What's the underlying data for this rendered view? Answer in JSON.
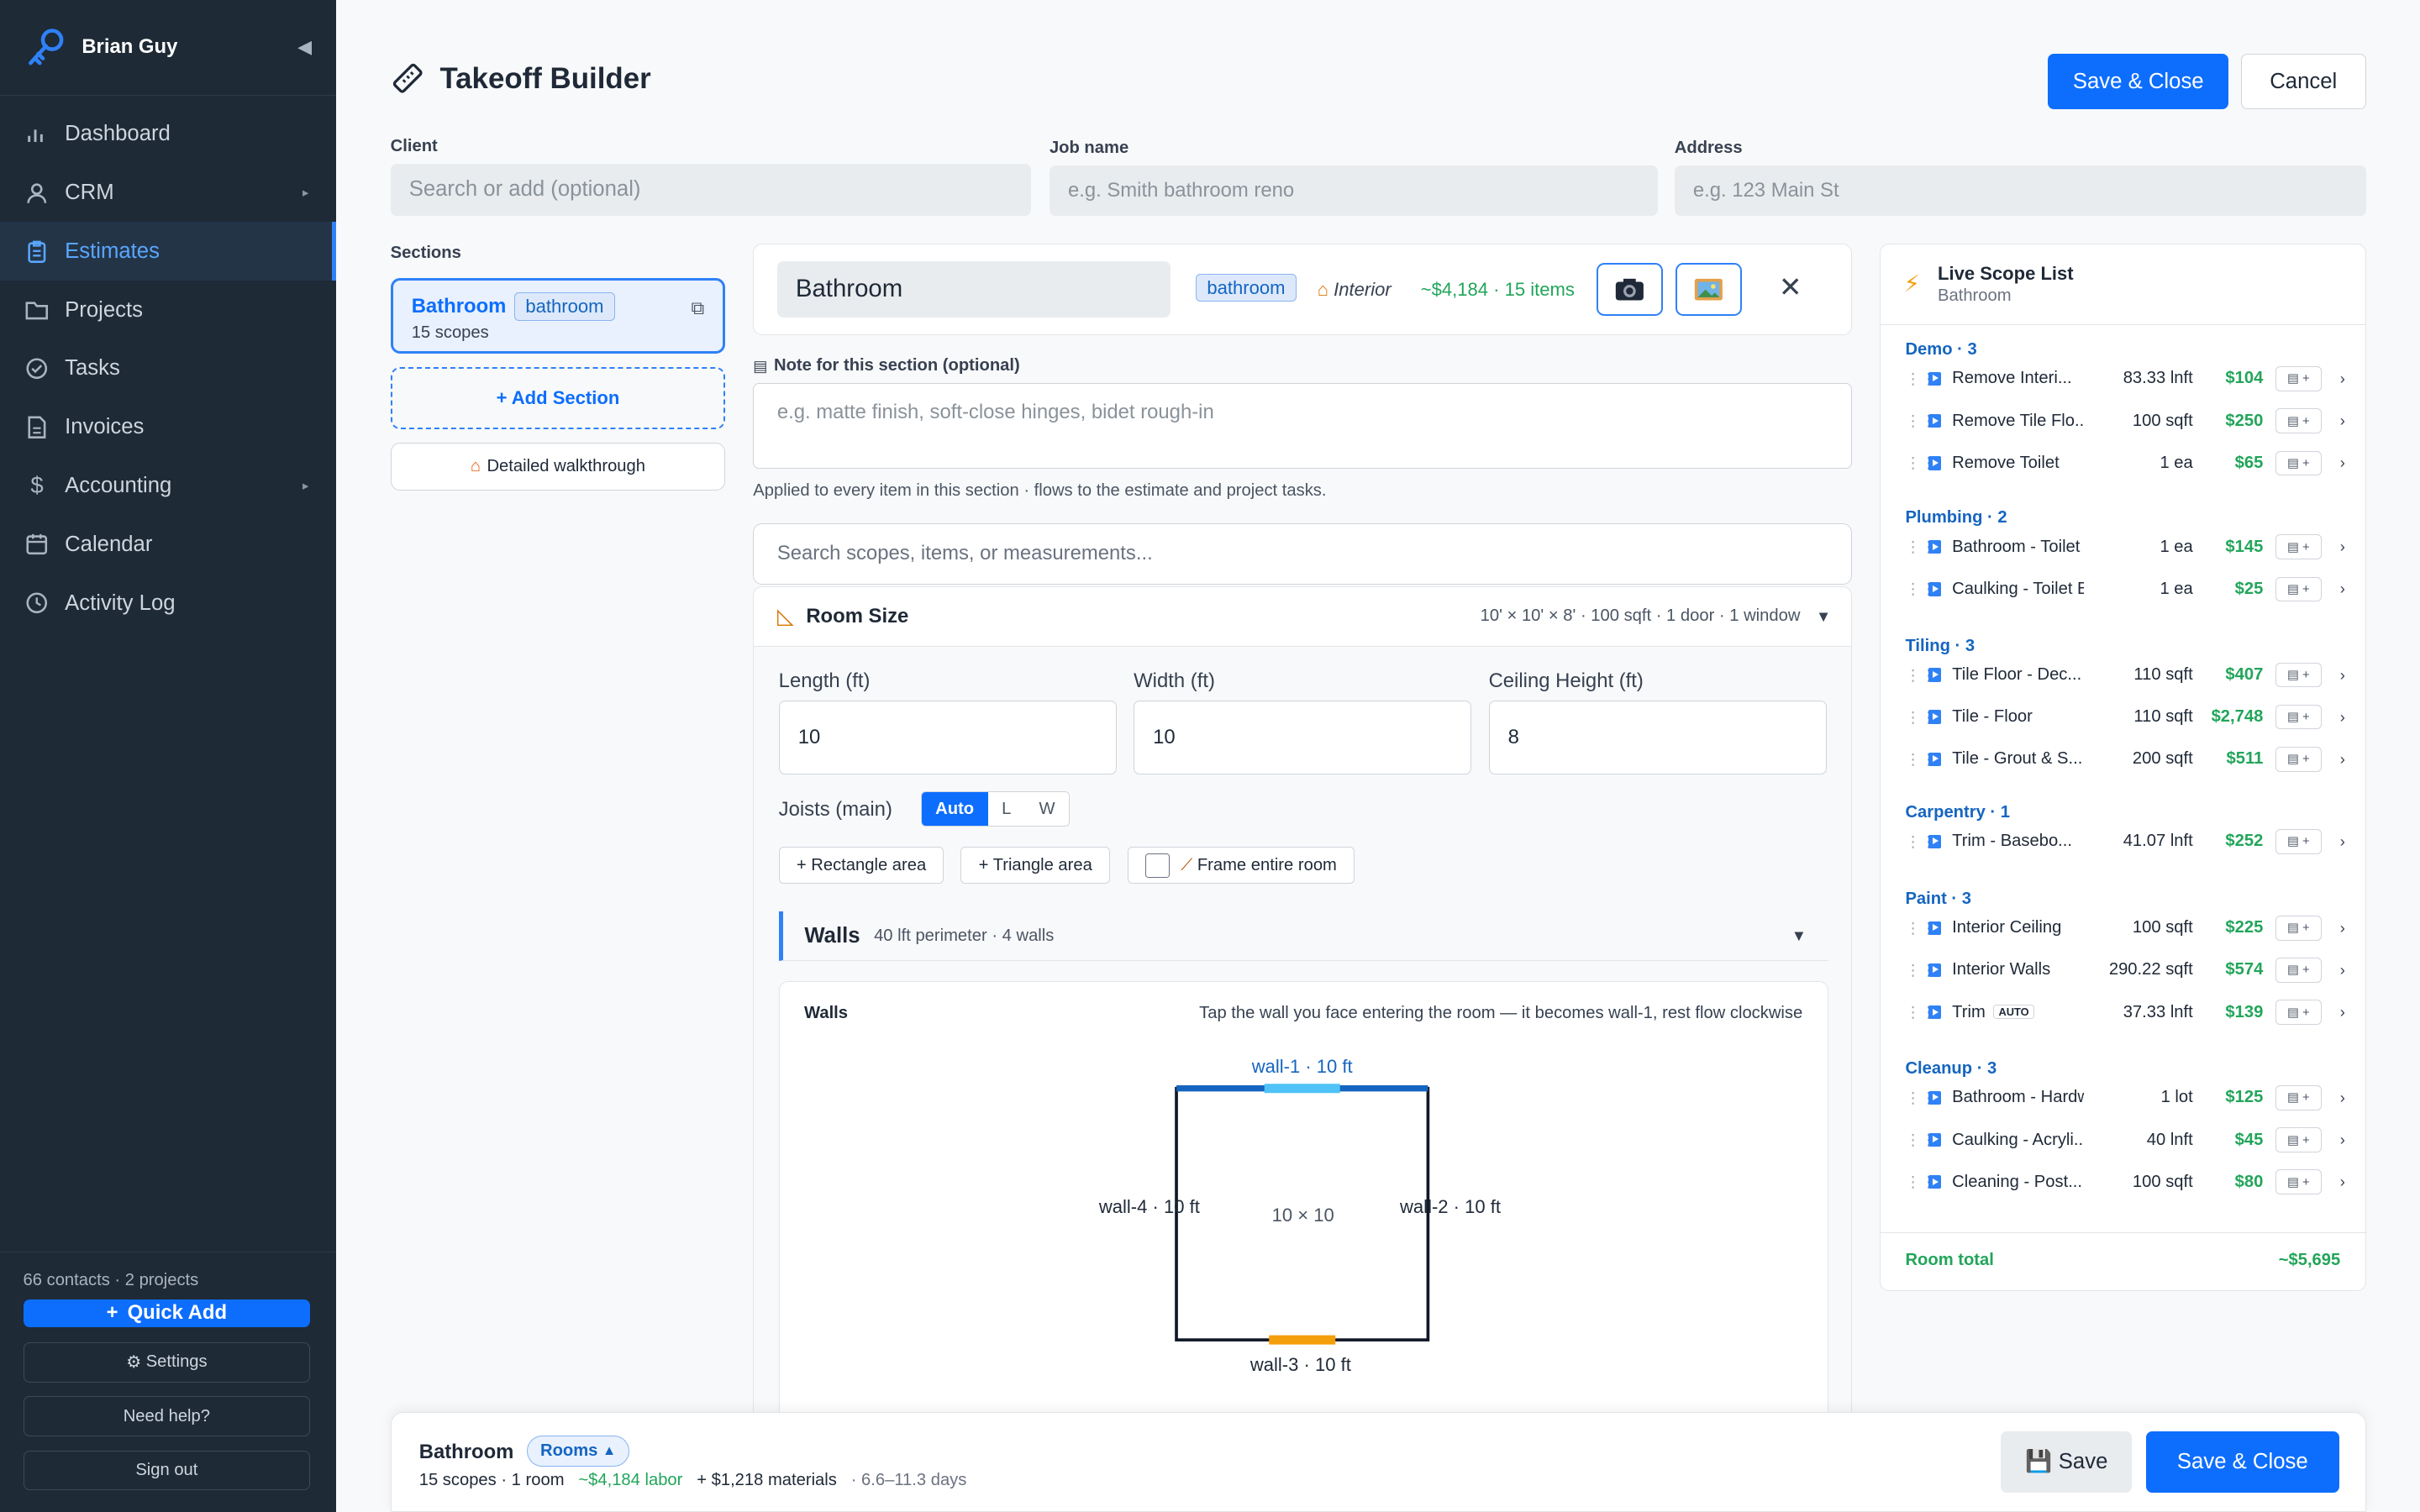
{
  "sidebar": {
    "user": "Brian Guy",
    "nav": [
      {
        "label": "Dashboard",
        "icon": "chart-icon"
      },
      {
        "label": "CRM",
        "icon": "user-icon"
      },
      {
        "label": "Estimates",
        "icon": "clipboard-icon"
      },
      {
        "label": "Projects",
        "icon": "folder-icon"
      },
      {
        "label": "Tasks",
        "icon": "check-circle-icon"
      },
      {
        "label": "Invoices",
        "icon": "document-icon"
      },
      {
        "label": "Accounting",
        "icon": "dollar-icon"
      },
      {
        "label": "Calendar",
        "icon": "calendar-icon"
      },
      {
        "label": "Activity Log",
        "icon": "clock-icon"
      }
    ],
    "active": "Estimates",
    "stats": "66 contacts · 2 projects",
    "quick_add": "Quick Add",
    "settings": "Settings",
    "help": "Need help?",
    "signout": "Sign out"
  },
  "header": {
    "title": "Takeoff Builder",
    "save_close": "Save & Close",
    "cancel": "Cancel"
  },
  "fields": {
    "client_label": "Client",
    "client_placeholder": "Search or add (optional)",
    "job_label": "Job name",
    "job_placeholder": "e.g. Smith bathroom reno",
    "address_label": "Address",
    "address_placeholder": "e.g. 123 Main St"
  },
  "sections": {
    "label": "Sections",
    "items": [
      {
        "name": "Bathroom",
        "tag": "bathroom",
        "sub": "15 scopes"
      }
    ],
    "add": "+ Add Section",
    "walkthrough": "Detailed walkthrough"
  },
  "section_header": {
    "name": "Bathroom",
    "tag": "bathroom",
    "interior": "Interior",
    "total": "~$4,184 · 15 items"
  },
  "note": {
    "label": "Note for this section (optional)",
    "placeholder": "e.g. matte finish, soft-close hinges, bidet rough-in",
    "hint": "Applied to every item in this section · flows to the estimate and project tasks."
  },
  "search": {
    "placeholder": "Search scopes, items, or measurements..."
  },
  "room_size": {
    "title": "Room Size",
    "meta": "10' × 10' × 8' · 100 sqft · 1 door · 1 window",
    "length_label": "Length (ft)",
    "length": "10",
    "width_label": "Width (ft)",
    "width": "10",
    "height_label": "Ceiling Height (ft)",
    "height": "8",
    "joists_label": "Joists (main)",
    "joists_options": [
      "Auto",
      "L",
      "W"
    ],
    "joists_selected": "Auto",
    "rect_area": "+ Rectangle area",
    "tri_area": "+ Triangle area",
    "frame_room": "Frame entire room",
    "frame_checked": false
  },
  "walls": {
    "title": "Walls",
    "meta": "40 lft perimeter · 4 walls",
    "card_title": "Walls",
    "hint": "Tap the wall you face entering the room — it becomes wall-1, rest flow clockwise",
    "wall1": "wall-1 · 10 ft",
    "wall2": "wall-2 · 10 ft",
    "wall3": "wall-3 · 10 ft",
    "wall4": "wall-4 · 10 ft",
    "center": "10 × 10"
  },
  "live": {
    "title": "Live Scope List",
    "subtitle": "Bathroom",
    "categories": [
      {
        "label": "Demo · 3",
        "items": [
          {
            "name": "Remove Interi...",
            "qty": "83.33 lnft",
            "price": "$104"
          },
          {
            "name": "Remove Tile Flo...",
            "qty": "100 sqft",
            "price": "$250"
          },
          {
            "name": "Remove Toilet",
            "qty": "1 ea",
            "price": "$65"
          }
        ]
      },
      {
        "label": "Plumbing · 2",
        "items": [
          {
            "name": "Bathroom - Toilet In...",
            "qty": "1 ea",
            "price": "$145"
          },
          {
            "name": "Caulking - Toilet Ba...",
            "qty": "1 ea",
            "price": "$25"
          }
        ]
      },
      {
        "label": "Tiling · 3",
        "items": [
          {
            "name": "Tile Floor - Dec...",
            "qty": "110 sqft",
            "price": "$407"
          },
          {
            "name": "Tile - Floor",
            "qty": "110 sqft",
            "price": "$2,748"
          },
          {
            "name": "Tile - Grout & S...",
            "qty": "200 sqft",
            "price": "$511"
          }
        ]
      },
      {
        "label": "Carpentry · 1",
        "items": [
          {
            "name": "Trim - Basebo...",
            "qty": "41.07 lnft",
            "price": "$252"
          }
        ]
      },
      {
        "label": "Paint · 3",
        "items": [
          {
            "name": "Interior Ceiling",
            "qty": "100 sqft",
            "price": "$225"
          },
          {
            "name": "Interior Walls",
            "qty": "290.22 sqft",
            "price": "$574"
          },
          {
            "name": "Trim",
            "badge": "AUTO",
            "qty": "37.33 lnft",
            "price": "$139"
          }
        ]
      },
      {
        "label": "Cleanup · 3",
        "items": [
          {
            "name": "Bathroom - Hardwa...",
            "qty": "1 lot",
            "price": "$125"
          },
          {
            "name": "Caulking - Acryli...",
            "qty": "40 lnft",
            "price": "$45"
          },
          {
            "name": "Cleaning - Post...",
            "qty": "100 sqft",
            "price": "$80"
          }
        ]
      }
    ],
    "total_label": "Room total",
    "total_value": "~$5,695"
  },
  "bottom": {
    "name": "Bathroom",
    "rooms": "Rooms",
    "scopes": "15 scopes · 1 room",
    "labor": "~$4,184 labor",
    "materials": "+ $1,218 materials",
    "days": "· 6.6–11.3 days",
    "save": "Save",
    "save_close": "Save & Close"
  },
  "colors": {
    "accent": "#0d6efd",
    "sidebar_bg": "#1e2a36",
    "money_green": "#22a55a",
    "wall_highlight_1": "#4fc3f7",
    "wall_highlight_3": "#f59e0b"
  }
}
